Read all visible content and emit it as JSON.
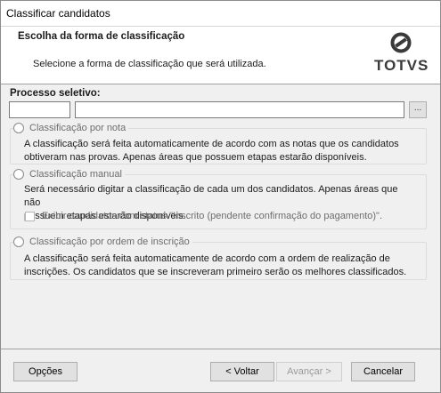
{
  "window": {
    "title": "Classificar candidatos"
  },
  "header": {
    "title": "Escolha da forma de classificação",
    "subtitle": "Selecione a forma de classificação que será utilizada.",
    "logo_text": "TOTVS"
  },
  "processo": {
    "label": "Processo seletivo:",
    "code_value": "",
    "name_value": "",
    "browse_label": "..."
  },
  "options": [
    {
      "label": "Classificação por nota",
      "description_lines": [
        "A classificação será feita automaticamente de acordo com as notas que os candidatos",
        "obtiveram nas provas. Apenas áreas que possuem etapas estarão disponíveis."
      ]
    },
    {
      "label": "Classificação manual",
      "description_lines": [
        "Será necessário digitar a classificação de cada um dos candidatos. Apenas áreas que não",
        "possuem etapas estarão disponíveis."
      ],
      "checkbox_label": "Exibir candidatos com status \"Inscrito (pendente confirmação do pagamento)\"."
    },
    {
      "label": "Classificação por ordem de inscrição",
      "description_lines": [
        "A classificação será feita automaticamente de acordo com a ordem de realização de",
        "inscrições. Os candidatos que se inscreveram primeiro serão os melhores classificados."
      ]
    }
  ],
  "footer": {
    "options_label": "Opções",
    "back_label": "< Voltar",
    "next_label": "Avançar >",
    "cancel_label": "Cancelar"
  },
  "colors": {
    "accent_disabled_text": "#6d6d6d",
    "logo": "#3a3a3a"
  }
}
